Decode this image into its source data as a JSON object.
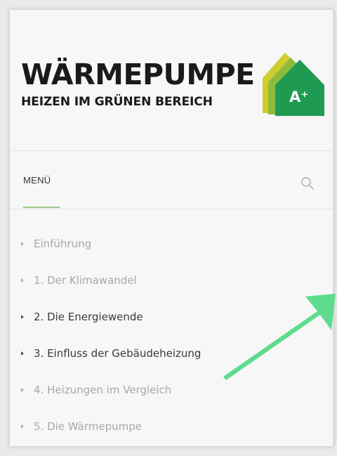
{
  "logo": {
    "title": "WÄRMEPUMPE",
    "subtitle": "HEIZEN IM GRÜNEN BEREICH",
    "badge": "A⁺",
    "icon": "house-energy-label-icon",
    "colors": {
      "green_dark": "#1f9a52",
      "green_light": "#8cbc3e",
      "yellow": "#cfcd2e"
    }
  },
  "menu": {
    "label": "MENÜ",
    "accent": "#9cc98a",
    "search_icon": "search-icon"
  },
  "nav": {
    "items": [
      {
        "label": "Einführung",
        "style": "muted"
      },
      {
        "label": "1. Der Klimawandel",
        "style": "muted"
      },
      {
        "label": "2. Die Energiewende",
        "style": "dark"
      },
      {
        "label": "3. Einfluss der Gebäudeheizung",
        "style": "dark"
      },
      {
        "label": "4. Heizungen im Vergleich",
        "style": "muted"
      },
      {
        "label": "5. Die Wärmepumpe",
        "style": "muted"
      }
    ]
  },
  "annotation": {
    "icon": "pointer-arrow-icon",
    "color": "#5edc8e"
  }
}
